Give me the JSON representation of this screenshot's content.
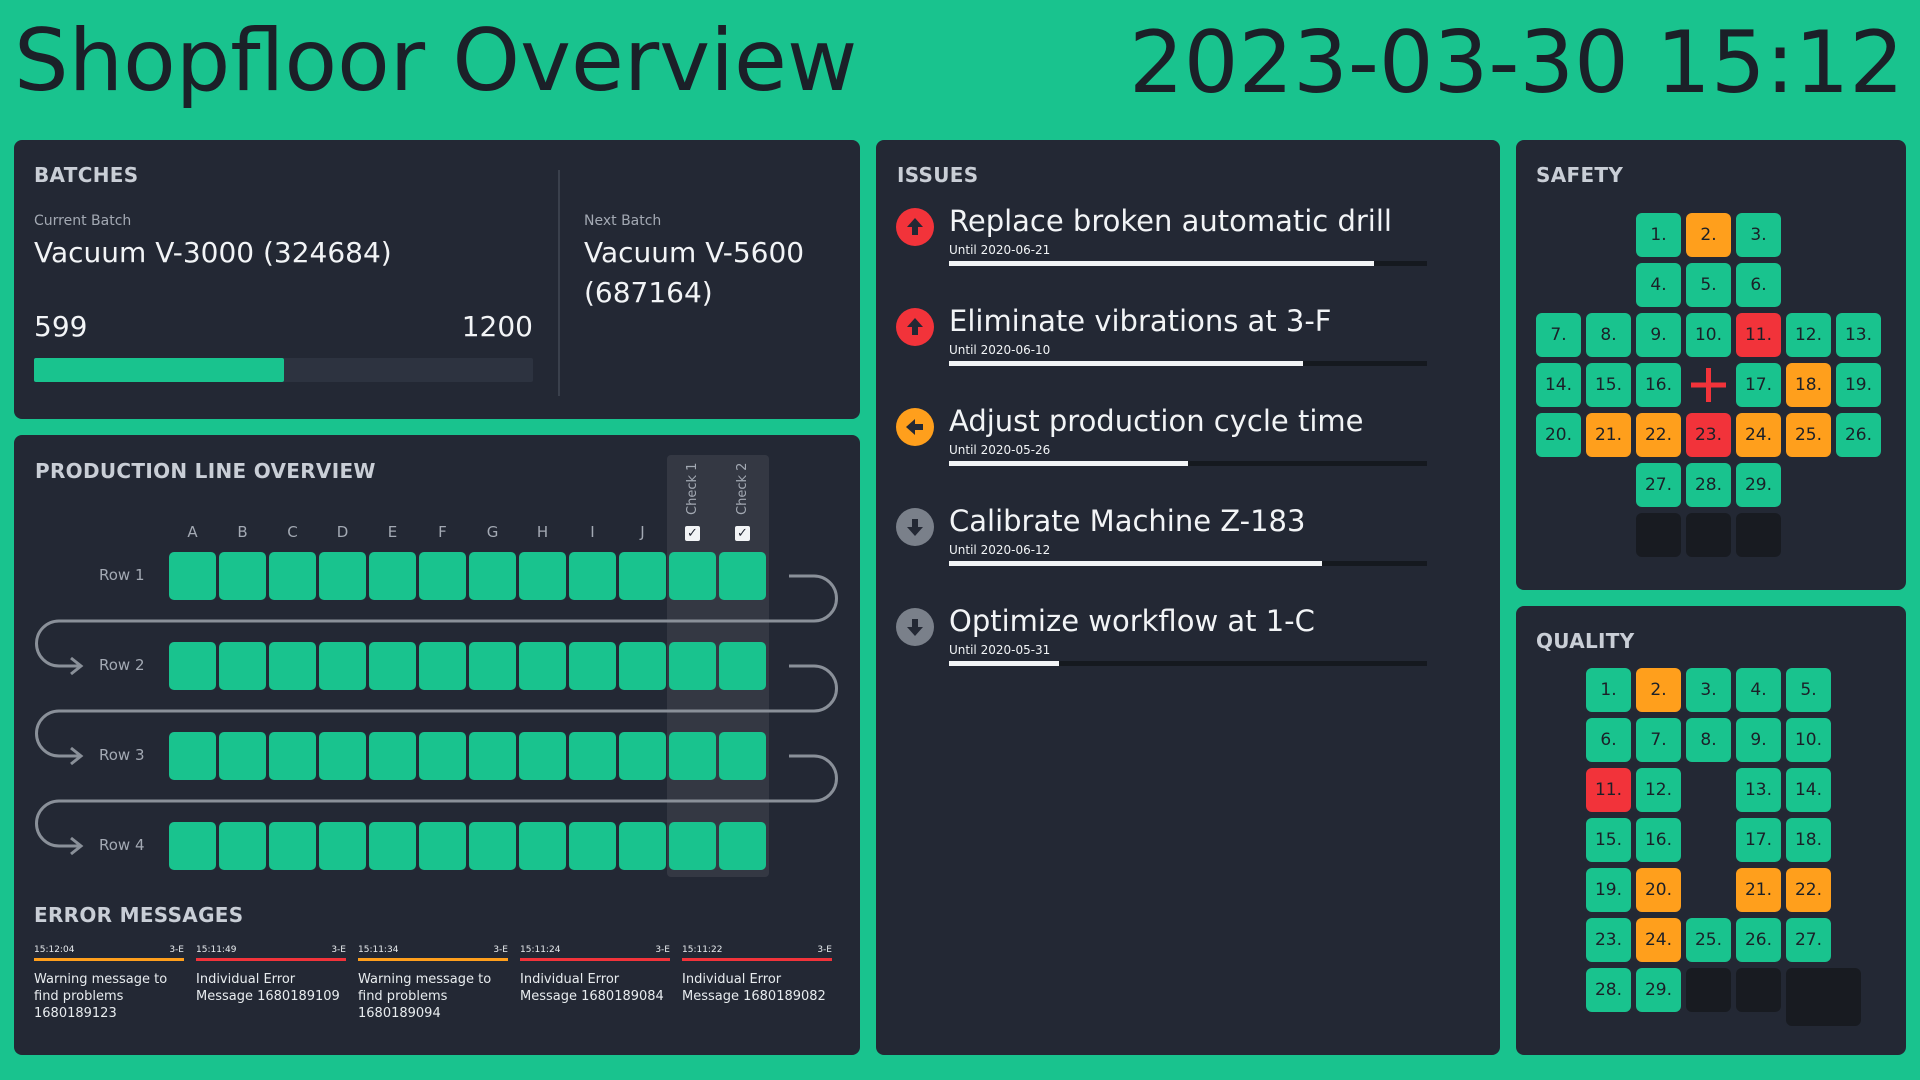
{
  "header": {
    "title": "Shopfloor Overview",
    "datetime": "2023-03-30 15:12"
  },
  "batches": {
    "title": "BATCHES",
    "current_label": "Current Batch",
    "current_name": "Vacuum V-3000 (324684)",
    "current_count": "599",
    "target_count": "1200",
    "progress": 0.5,
    "next_label": "Next Batch",
    "next_name": "Vacuum V-5600 (687164)"
  },
  "production": {
    "title": "PRODUCTION LINE OVERVIEW",
    "columns": [
      "A",
      "B",
      "C",
      "D",
      "E",
      "F",
      "G",
      "H",
      "I",
      "J"
    ],
    "checks": [
      "Check 1",
      "Check 2"
    ],
    "rows": [
      "Row 1",
      "Row 2",
      "Row 3",
      "Row 4"
    ]
  },
  "errors": {
    "title": "ERROR MESSAGES",
    "items": [
      {
        "time": "15:12:04",
        "code": "3-E",
        "message": "Warning message to find problems 1680189123",
        "color": "#ff9f1c"
      },
      {
        "time": "15:11:49",
        "code": "3-E",
        "message": "Individual Error Message 1680189109",
        "color": "#f2333a"
      },
      {
        "time": "15:11:34",
        "code": "3-E",
        "message": "Warning message to find problems 1680189094",
        "color": "#ff9f1c"
      },
      {
        "time": "15:11:24",
        "code": "3-E",
        "message": "Individual Error Message 1680189084",
        "color": "#f2333a"
      },
      {
        "time": "15:11:22",
        "code": "3-E",
        "message": "Individual Error Message 1680189082",
        "color": "#f2333a"
      }
    ]
  },
  "issues": {
    "title": "ISSUES",
    "items": [
      {
        "title": "Replace broken automatic drill",
        "until": "Until  2020-06-21",
        "progress": 0.89,
        "priority": "high",
        "icon": "arrow-up-icon",
        "color": "#f2333a"
      },
      {
        "title": "Eliminate vibrations at 3-F",
        "until": "Until  2020-06-10",
        "progress": 0.74,
        "priority": "high",
        "icon": "arrow-up-icon",
        "color": "#f2333a"
      },
      {
        "title": "Adjust production cycle time",
        "until": "Until  2020-05-26",
        "progress": 0.5,
        "priority": "medium",
        "icon": "arrow-left-icon",
        "color": "#ff9f1c"
      },
      {
        "title": "Calibrate Machine Z-183",
        "until": "Until  2020-06-12",
        "progress": 0.78,
        "priority": "low",
        "icon": "arrow-down-icon",
        "color": "#7a808a"
      },
      {
        "title": "Optimize workflow at 1-C",
        "until": "Until  2020-05-31",
        "progress": 0.23,
        "priority": "low",
        "icon": "arrow-down-icon",
        "color": "#7a808a"
      }
    ]
  },
  "safety": {
    "title": "SAFETY",
    "days": [
      {
        "label": "1.",
        "status": "ok"
      },
      {
        "label": "2.",
        "status": "warn"
      },
      {
        "label": "3.",
        "status": "ok"
      },
      {
        "label": "4.",
        "status": "ok"
      },
      {
        "label": "5.",
        "status": "ok"
      },
      {
        "label": "6.",
        "status": "ok"
      },
      {
        "label": "7.",
        "status": "ok"
      },
      {
        "label": "8.",
        "status": "ok"
      },
      {
        "label": "9.",
        "status": "ok"
      },
      {
        "label": "10.",
        "status": "ok"
      },
      {
        "label": "11.",
        "status": "alert"
      },
      {
        "label": "12.",
        "status": "ok"
      },
      {
        "label": "13.",
        "status": "ok"
      },
      {
        "label": "14.",
        "status": "ok"
      },
      {
        "label": "15.",
        "status": "ok"
      },
      {
        "label": "16.",
        "status": "ok"
      },
      {
        "label": "17.",
        "status": "ok"
      },
      {
        "label": "18.",
        "status": "warn"
      },
      {
        "label": "19.",
        "status": "ok"
      },
      {
        "label": "20.",
        "status": "ok"
      },
      {
        "label": "21.",
        "status": "warn"
      },
      {
        "label": "22.",
        "status": "warn"
      },
      {
        "label": "23.",
        "status": "alert"
      },
      {
        "label": "24.",
        "status": "warn"
      },
      {
        "label": "25.",
        "status": "warn"
      },
      {
        "label": "26.",
        "status": "ok"
      },
      {
        "label": "27.",
        "status": "ok"
      },
      {
        "label": "28.",
        "status": "ok"
      },
      {
        "label": "29.",
        "status": "ok"
      }
    ]
  },
  "quality": {
    "title": "QUALITY",
    "days": [
      {
        "label": "1.",
        "status": "ok"
      },
      {
        "label": "2.",
        "status": "warn"
      },
      {
        "label": "3.",
        "status": "ok"
      },
      {
        "label": "4.",
        "status": "ok"
      },
      {
        "label": "5.",
        "status": "ok"
      },
      {
        "label": "6.",
        "status": "ok"
      },
      {
        "label": "7.",
        "status": "ok"
      },
      {
        "label": "8.",
        "status": "ok"
      },
      {
        "label": "9.",
        "status": "ok"
      },
      {
        "label": "10.",
        "status": "ok"
      },
      {
        "label": "11.",
        "status": "alert"
      },
      {
        "label": "12.",
        "status": "ok"
      },
      {
        "label": "13.",
        "status": "ok"
      },
      {
        "label": "14.",
        "status": "ok"
      },
      {
        "label": "15.",
        "status": "ok"
      },
      {
        "label": "16.",
        "status": "ok"
      },
      {
        "label": "17.",
        "status": "ok"
      },
      {
        "label": "18.",
        "status": "ok"
      },
      {
        "label": "19.",
        "status": "ok"
      },
      {
        "label": "20.",
        "status": "warn"
      },
      {
        "label": "21.",
        "status": "warn"
      },
      {
        "label": "22.",
        "status": "warn"
      },
      {
        "label": "23.",
        "status": "ok"
      },
      {
        "label": "24.",
        "status": "warn"
      },
      {
        "label": "25.",
        "status": "ok"
      },
      {
        "label": "26.",
        "status": "ok"
      },
      {
        "label": "27.",
        "status": "ok"
      },
      {
        "label": "28.",
        "status": "ok"
      },
      {
        "label": "29.",
        "status": "ok"
      }
    ]
  },
  "colors": {
    "accent": "#19c38e",
    "warn": "#ff9f1c",
    "alert": "#f2333a",
    "panel": "#232834"
  }
}
